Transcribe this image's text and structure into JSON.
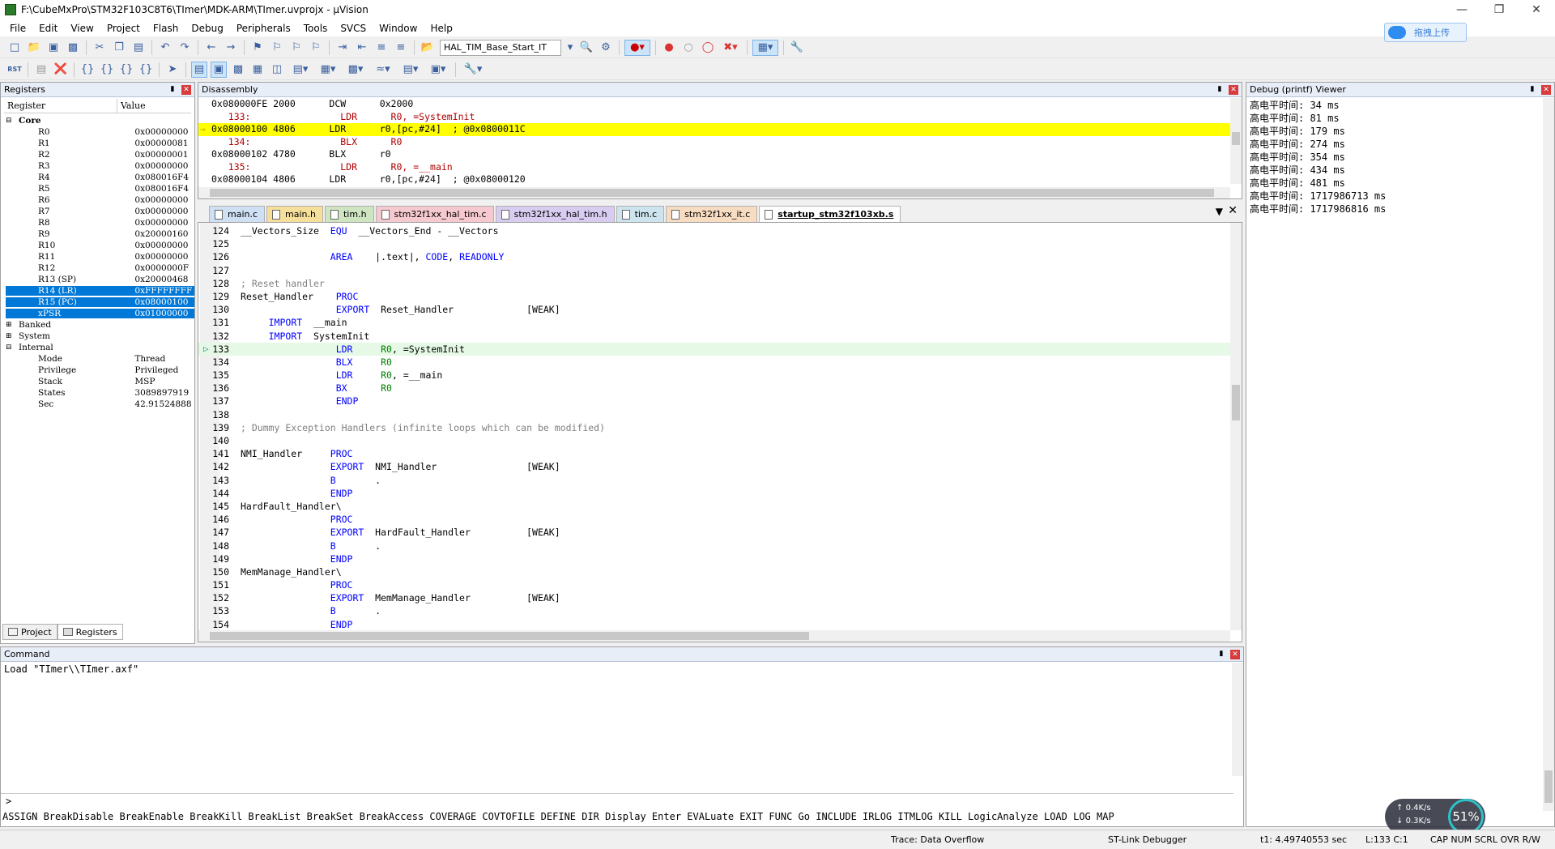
{
  "window": {
    "title": "F:\\CubeMxPro\\STM32F103C8T6\\TImer\\MDK-ARM\\TImer.uvprojx - µVision",
    "upload_label": "拖拽上传"
  },
  "menu": [
    "File",
    "Edit",
    "View",
    "Project",
    "Flash",
    "Debug",
    "Peripherals",
    "Tools",
    "SVCS",
    "Window",
    "Help"
  ],
  "toolbar": {
    "target_combo": "HAL_TIM_Base_Start_IT"
  },
  "registers": {
    "title": "Registers",
    "col_register": "Register",
    "col_value": "Value",
    "groups": [
      {
        "label": "Core"
      }
    ],
    "core": [
      {
        "name": "R0",
        "value": "0x00000000"
      },
      {
        "name": "R1",
        "value": "0x00000081"
      },
      {
        "name": "R2",
        "value": "0x00000001"
      },
      {
        "name": "R3",
        "value": "0x00000000"
      },
      {
        "name": "R4",
        "value": "0x080016F4"
      },
      {
        "name": "R5",
        "value": "0x080016F4"
      },
      {
        "name": "R6",
        "value": "0x00000000"
      },
      {
        "name": "R7",
        "value": "0x00000000"
      },
      {
        "name": "R8",
        "value": "0x00000000"
      },
      {
        "name": "R9",
        "value": "0x20000160"
      },
      {
        "name": "R10",
        "value": "0x00000000"
      },
      {
        "name": "R11",
        "value": "0x00000000"
      },
      {
        "name": "R12",
        "value": "0x0000000F"
      },
      {
        "name": "R13 (SP)",
        "value": "0x20000468"
      },
      {
        "name": "R14 (LR)",
        "value": "0xFFFFFFFF",
        "sel": true
      },
      {
        "name": "R15 (PC)",
        "value": "0x08000100",
        "sel": true
      },
      {
        "name": "xPSR",
        "value": "0x01000000",
        "sel": true
      }
    ],
    "other_groups": [
      "Banked",
      "System",
      "Internal"
    ],
    "internal": [
      {
        "name": "Mode",
        "value": "Thread"
      },
      {
        "name": "Privilege",
        "value": "Privileged"
      },
      {
        "name": "Stack",
        "value": "MSP"
      },
      {
        "name": "States",
        "value": "3089897919"
      },
      {
        "name": "Sec",
        "value": "42.91524888"
      }
    ],
    "bottom_tabs": [
      "Project",
      "Registers"
    ]
  },
  "disassembly": {
    "title": "Disassembly",
    "lines": [
      {
        "text": "0x080000FE 2000      DCW      0x2000",
        "type": "asm"
      },
      {
        "text": "   133:                LDR      R0, =SystemInit",
        "type": "src"
      },
      {
        "text": "0x08000100 4806      LDR      r0,[pc,#24]  ; @0x0800011C",
        "type": "cur"
      },
      {
        "text": "   134:                BLX      R0",
        "type": "src"
      },
      {
        "text": "0x08000102 4780      BLX      r0",
        "type": "asm"
      },
      {
        "text": "   135:                LDR      R0, =__main",
        "type": "src"
      },
      {
        "text": "0x08000104 4806      LDR      r0,[pc,#24]  ; @0x08000120",
        "type": "asm"
      }
    ]
  },
  "editor": {
    "tabs": [
      {
        "label": "main.c",
        "color": "#cfe0f5"
      },
      {
        "label": "main.h",
        "color": "#f5df9a"
      },
      {
        "label": "tim.h",
        "color": "#cfe5c2"
      },
      {
        "label": "stm32f1xx_hal_tim.c",
        "color": "#f5c9cf"
      },
      {
        "label": "stm32f1xx_hal_tim.h",
        "color": "#d8cdf0"
      },
      {
        "label": "tim.c",
        "color": "#cde3ee"
      },
      {
        "label": "stm32f1xx_it.c",
        "color": "#f8dcc2"
      },
      {
        "label": "startup_stm32f103xb.s",
        "color": "#ffffff",
        "active": true
      }
    ],
    "lines": [
      {
        "n": "124",
        "code": "__Vectors_Size  <k>EQU</k>  __Vectors_End - __Vectors"
      },
      {
        "n": "125",
        "code": ""
      },
      {
        "n": "126",
        "code": "                <k>AREA</k>    |.text|, <k>CODE</k>, <k>READONLY</k>"
      },
      {
        "n": "127",
        "code": ""
      },
      {
        "n": "128",
        "code": "<c>; Reset handler</c>"
      },
      {
        "n": "129",
        "code": "Reset_Handler    <k>PROC</k>"
      },
      {
        "n": "130",
        "code": "                 <k>EXPORT</k>  Reset_Handler             [WEAK]"
      },
      {
        "n": "131",
        "code": "     <k>IMPORT</k>  __main"
      },
      {
        "n": "132",
        "code": "     <k>IMPORT</k>  SystemInit"
      },
      {
        "n": "133",
        "code": "                 <k>LDR</k>     <g>R0</g>, =SystemInit",
        "cur": true
      },
      {
        "n": "134",
        "code": "                 <k>BLX</k>     <g>R0</g>"
      },
      {
        "n": "135",
        "code": "                 <k>LDR</k>     <g>R0</g>, =__main"
      },
      {
        "n": "136",
        "code": "                 <k>BX</k>      <g>R0</g>"
      },
      {
        "n": "137",
        "code": "                 <k>ENDP</k>"
      },
      {
        "n": "138",
        "code": ""
      },
      {
        "n": "139",
        "code": "<c>; Dummy Exception Handlers (infinite loops which can be modified)</c>"
      },
      {
        "n": "140",
        "code": ""
      },
      {
        "n": "141",
        "code": "NMI_Handler     <k>PROC</k>"
      },
      {
        "n": "142",
        "code": "                <k>EXPORT</k>  NMI_Handler                [WEAK]"
      },
      {
        "n": "143",
        "code": "                <k>B</k>       ."
      },
      {
        "n": "144",
        "code": "                <k>ENDP</k>"
      },
      {
        "n": "145",
        "code": "HardFault_Handler\\"
      },
      {
        "n": "146",
        "code": "                <k>PROC</k>"
      },
      {
        "n": "147",
        "code": "                <k>EXPORT</k>  HardFault_Handler          [WEAK]"
      },
      {
        "n": "148",
        "code": "                <k>B</k>       ."
      },
      {
        "n": "149",
        "code": "                <k>ENDP</k>"
      },
      {
        "n": "150",
        "code": "MemManage_Handler\\"
      },
      {
        "n": "151",
        "code": "                <k>PROC</k>"
      },
      {
        "n": "152",
        "code": "                <k>EXPORT</k>  MemManage_Handler          [WEAK]"
      },
      {
        "n": "153",
        "code": "                <k>B</k>       ."
      },
      {
        "n": "154",
        "code": "                <k>ENDP</k>"
      }
    ]
  },
  "debug_viewer": {
    "title": "Debug (printf) Viewer",
    "lines": [
      "高电平时间: 34 ms",
      "高电平时间: 81 ms",
      "高电平时间: 179 ms",
      "高电平时间: 274 ms",
      "高电平时间: 354 ms",
      "高电平时间: 434 ms",
      "高电平时间: 481 ms",
      "高电平时间: 1717986713 ms",
      "高电平时间: 1717986816 ms"
    ]
  },
  "command": {
    "title": "Command",
    "output": "Load \"TImer\\\\TImer.axf\"",
    "prompt": ">",
    "hints": "ASSIGN BreakDisable BreakEnable BreakKill BreakList BreakSet BreakAccess COVERAGE COVTOFILE DEFINE DIR Display Enter EVALuate EXIT FUNC Go INCLUDE IRLOG ITMLOG KILL LogicAnalyze LOAD LOG MAP"
  },
  "status": {
    "trace": "Trace: Data Overflow",
    "debugger": "ST-Link Debugger",
    "time": "t1: 4.49740553 sec",
    "pos": "L:133 C:1",
    "flags": "CAP  NUM  SCRL  OVR  R/W"
  },
  "netmon": {
    "up": "0.4K/s",
    "down": "0.3K/s",
    "percent": "51%"
  }
}
